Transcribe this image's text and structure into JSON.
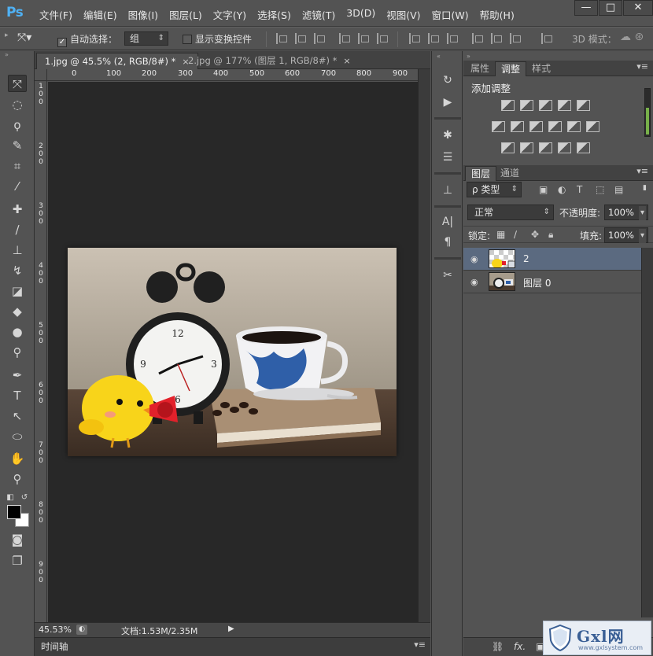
{
  "app": {
    "logo": "Ps",
    "menu": [
      "文件(F)",
      "编辑(E)",
      "图像(I)",
      "图层(L)",
      "文字(Y)",
      "选择(S)",
      "滤镜(T)",
      "3D(D)",
      "视图(V)",
      "窗口(W)",
      "帮助(H)"
    ],
    "window_controls": {
      "minimize": "—",
      "maximize": "□",
      "close": "✕"
    }
  },
  "options_bar": {
    "auto_select_label": "自动选择：",
    "auto_select_checked": true,
    "auto_select_target": "组",
    "show_transform_label": "显示变换控件",
    "show_transform_checked": false,
    "mode_3d_label": "3D 模式："
  },
  "documents": {
    "tabs": [
      {
        "label": "1.jpg @ 45.5% (2, RGB/8#) *",
        "active": true
      },
      {
        "label": "2.jpg @ 177% (图层 1, RGB/8#) *",
        "active": false
      }
    ],
    "close_glyph": "×"
  },
  "ruler": {
    "horizontal": [
      "0",
      "100",
      "200",
      "300",
      "400",
      "500",
      "600",
      "700",
      "800",
      "900"
    ],
    "vertical": [
      "1",
      "0",
      "0",
      "2",
      "0",
      "0",
      "3",
      "0",
      "0",
      "4",
      "0",
      "0",
      "5",
      "0",
      "0",
      "6",
      "0",
      "0",
      "7",
      "0",
      "0",
      "8",
      "0",
      "0",
      "9",
      "0",
      "0"
    ]
  },
  "status": {
    "zoom": "45.53%",
    "doc_size": "文档:1.53M/2.35M",
    "timeline": "时间轴"
  },
  "panels": {
    "top_tabs": [
      "属性",
      "调整",
      "样式"
    ],
    "top_active": "调整",
    "adjust_title": "添加调整",
    "layer_tabs": [
      "图层",
      "通道"
    ],
    "layer_active": "图层",
    "filter_type": "ρ 类型",
    "blend_mode": "正常",
    "opacity_label": "不透明度:",
    "opacity_value": "100%",
    "lock_label": "锁定:",
    "fill_label": "填充:",
    "fill_value": "100%",
    "layers": [
      {
        "name": "2",
        "selected": true
      },
      {
        "name": "图层 0",
        "selected": false
      }
    ]
  },
  "watermark": {
    "brand": "Gxl网",
    "url": "www.gxlsystem.com"
  },
  "colors": {
    "accent": "#4fb1f4",
    "selected_layer": "#5b6a80",
    "canvas_bg": "#282828"
  }
}
